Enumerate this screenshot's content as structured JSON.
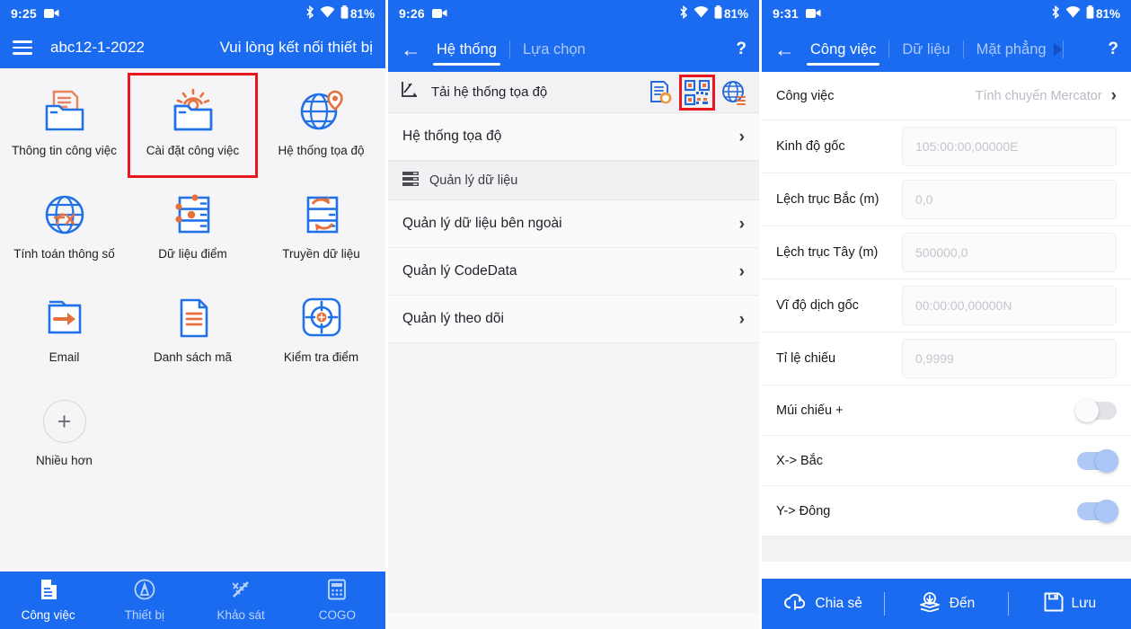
{
  "panel1": {
    "statusbar": {
      "time": "9:25",
      "battery": "81%",
      "icons": [
        "camera-icon",
        "bluetooth-icon",
        "wifi-icon",
        "battery-icon"
      ]
    },
    "appbar": {
      "menu_icon": "hamburger-icon",
      "title": "abc12-1-2022",
      "right_text": "Vui lòng kết nối thiết bị"
    },
    "grid": [
      {
        "label": "Thông tin công việc",
        "icon": "folder-document-icon",
        "highlighted": false
      },
      {
        "label": "Cài đặt công việc",
        "icon": "folder-gear-icon",
        "highlighted": true
      },
      {
        "label": "Hệ thống tọa độ",
        "icon": "globe-pin-icon",
        "highlighted": false
      },
      {
        "label": "Tính toán thông số",
        "icon": "globe-fx-icon",
        "highlighted": false
      },
      {
        "label": "Dữ liệu điểm",
        "icon": "database-points-icon",
        "highlighted": false
      },
      {
        "label": "Truyền dữ liệu",
        "icon": "database-transfer-icon",
        "highlighted": false
      },
      {
        "label": "Email",
        "icon": "folder-arrow-icon",
        "highlighted": false
      },
      {
        "label": "Danh sách mã",
        "icon": "document-lines-icon",
        "highlighted": false
      },
      {
        "label": "Kiểm tra điểm",
        "icon": "target-crosshair-icon",
        "highlighted": false
      },
      {
        "label": "Nhiều hơn",
        "icon": "plus-circle-icon",
        "highlighted": false
      }
    ],
    "bottomnav": [
      {
        "label": "Công việc",
        "icon": "document-job-icon",
        "active": true
      },
      {
        "label": "Thiết bị",
        "icon": "antenna-signal-icon",
        "active": false
      },
      {
        "label": "Khảo sát",
        "icon": "survey-ruler-icon",
        "active": false
      },
      {
        "label": "COGO",
        "icon": "calculator-icon",
        "active": false
      }
    ]
  },
  "panel2": {
    "statusbar": {
      "time": "9:26",
      "battery": "81%"
    },
    "tabbar": {
      "back_icon": "back-arrow-icon",
      "tabs": [
        {
          "label": "Hệ thống",
          "active": true
        },
        {
          "label": "Lựa chọn",
          "active": false
        }
      ],
      "help_label": "?"
    },
    "toolrow": {
      "icon": "axes-chart-icon",
      "label": "Tải hệ thống tọa độ",
      "actions": [
        {
          "icon": "document-shield-icon",
          "highlighted": false
        },
        {
          "icon": "qr-code-icon",
          "highlighted": true
        },
        {
          "icon": "globe-list-icon",
          "highlighted": false
        }
      ]
    },
    "rows": [
      {
        "type": "link",
        "label": "Hệ thống tọa độ",
        "icon": null
      },
      {
        "type": "section",
        "label": "Quản lý dữ liệu",
        "icon": "database-stack-icon"
      },
      {
        "type": "link",
        "label": "Quản lý dữ liệu bên ngoài",
        "icon": null
      },
      {
        "type": "link",
        "label": "Quản lý CodeData",
        "icon": null
      },
      {
        "type": "link",
        "label": "Quản lý theo dõi",
        "icon": null
      }
    ],
    "chevron": "›"
  },
  "panel3": {
    "statusbar": {
      "time": "9:31",
      "battery": "81%"
    },
    "tabbar": {
      "back_icon": "back-arrow-icon",
      "tabs": [
        {
          "label": "Công việc",
          "active": true
        },
        {
          "label": "Dữ liệu",
          "active": false
        },
        {
          "label": "Mặt phẳng",
          "active": false
        }
      ],
      "scroll_indicator": "scroll-right-triangle-icon",
      "help_label": "?"
    },
    "job_row": {
      "label": "Công việc",
      "value": "Tính chuyển Mercator",
      "chevron": "›"
    },
    "fields": [
      {
        "label": "Kinh độ gốc",
        "value": "105:00:00,00000E"
      },
      {
        "label": "Lệch trục Bắc (m)",
        "value": "0,0"
      },
      {
        "label": "Lệch trục Tây (m)",
        "value": "500000,0"
      },
      {
        "label": "Vĩ độ dịch gốc",
        "value": "00:00:00,00000N"
      },
      {
        "label": "Tỉ lệ chiếu",
        "value": "0,9999"
      }
    ],
    "toggles": [
      {
        "label": "Múi chiếu +",
        "on": false
      },
      {
        "label": "X-> Bắc",
        "on": true
      },
      {
        "label": "Y-> Đông",
        "on": true
      }
    ],
    "bottombar": [
      {
        "label": "Chia sẻ",
        "icon": "cloud-share-icon"
      },
      {
        "label": "Đến",
        "icon": "layers-download-icon"
      },
      {
        "label": "Lưu",
        "icon": "floppy-save-icon"
      }
    ]
  },
  "colors": {
    "brand_blue": "#1a6bf0",
    "accent_orange": "#e8703c",
    "highlight_red": "#e8161f",
    "toggle_on": "#aec9f6"
  }
}
